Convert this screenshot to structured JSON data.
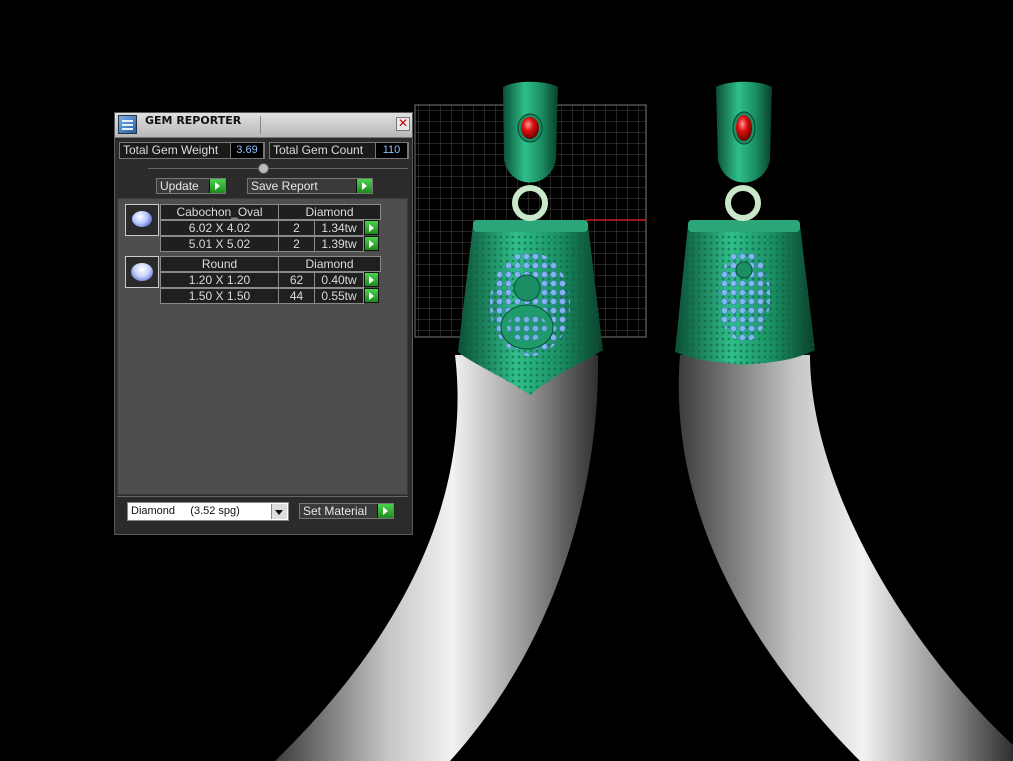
{
  "panel": {
    "title": "GEM REPORTER",
    "total_gem_weight_label": "Total Gem Weight",
    "total_gem_weight_value": "3.69",
    "total_gem_count_label": "Total Gem Count",
    "total_gem_count_value": "110",
    "update_label": "Update",
    "save_report_label": "Save Report",
    "groups": [
      {
        "icon": "oval-cabochon-gem-icon",
        "shape": "Cabochon_Oval",
        "material": "Diamond",
        "rows": [
          {
            "size": "6.02 X 4.02",
            "count": "2",
            "weight": "1.34tw"
          },
          {
            "size": "5.01 X 5.02",
            "count": "2",
            "weight": "1.39tw"
          }
        ]
      },
      {
        "icon": "round-gem-icon",
        "shape": "Round",
        "material": "Diamond",
        "rows": [
          {
            "size": "1.20 X 1.20",
            "count": "62",
            "weight": "0.40tw"
          },
          {
            "size": "1.50 X 1.50",
            "count": "44",
            "weight": "0.55tw"
          }
        ]
      }
    ],
    "material_select_value": "Diamond     (3.52 spg)",
    "set_material_label": "Set Material"
  },
  "colors": {
    "background": "#000000",
    "jade_green": "#1a9a6e",
    "horn_gray": "#a0a0a0",
    "ruby": "#d01010",
    "gem_blue": "#8fb8ff",
    "go_button_green": "#2eb82e"
  }
}
